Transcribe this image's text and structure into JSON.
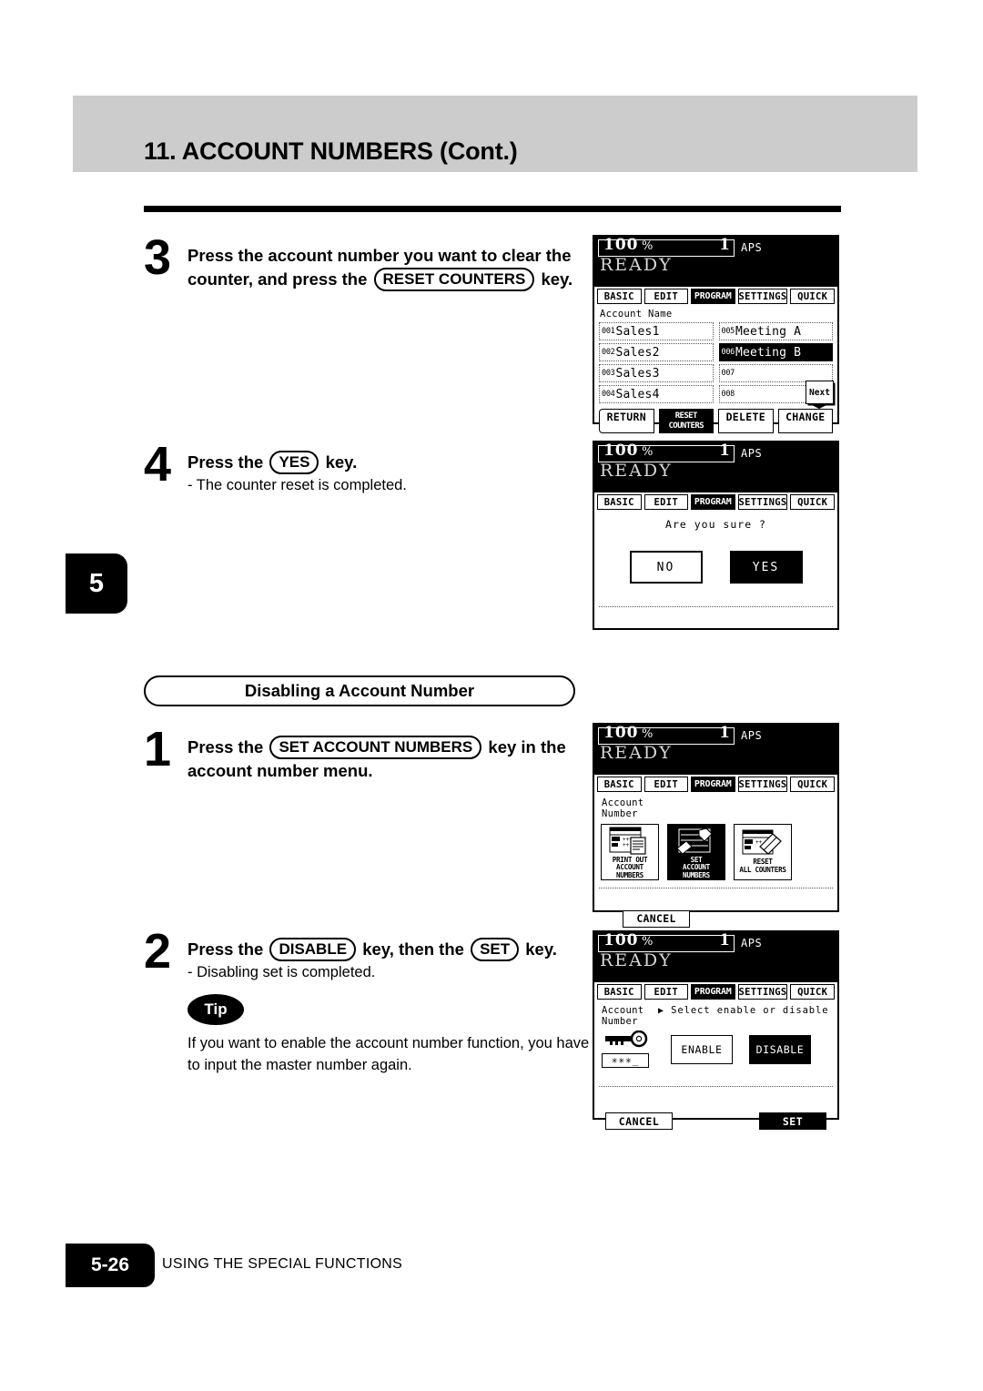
{
  "header": {
    "title": "11. ACCOUNT NUMBERS (Cont.)"
  },
  "chapter_tab": "5",
  "footer": {
    "page": "5-26",
    "text": "USING THE SPECIAL FUNCTIONS"
  },
  "section_heading": "Disabling a Account Number",
  "steps": {
    "step3": {
      "num": "3",
      "line1": "Press the account number you want to clear the",
      "line2a": "counter, and press the",
      "key": "RESET COUNTERS",
      "line2b": "key."
    },
    "step4": {
      "num": "4",
      "pre": "Press the",
      "key": "YES",
      "post": "key.",
      "sub": "- The counter reset is completed."
    },
    "step1": {
      "num": "1",
      "pre": "Press the",
      "key": "SET ACCOUNT NUMBERS",
      "post": "key in the",
      "line2": "account number menu."
    },
    "step2": {
      "num": "2",
      "pre": "Press the",
      "key1": "DISABLE",
      "mid": "key, then the",
      "key2": "SET",
      "post": "key.",
      "sub": "- Disabling set is completed.",
      "tip_badge": "Tip",
      "tip_text": "If you want to enable the account number function, you have to input the master number again."
    }
  },
  "lcd_common": {
    "ratio": "100",
    "percent": "%",
    "copies": "1",
    "aps": "APS",
    "ready": "READY",
    "tabs": [
      {
        "label": "BASIC",
        "selected": false
      },
      {
        "label": "EDIT",
        "selected": false
      },
      {
        "label": "PROGRAM",
        "selected": true
      },
      {
        "label": "SETTINGS",
        "selected": false
      },
      {
        "label": "QUICK",
        "selected": false
      }
    ]
  },
  "lcd1": {
    "list_label": "Account Name",
    "col_left": [
      {
        "index": "001",
        "name": "Sales1",
        "selected": false
      },
      {
        "index": "002",
        "name": "Sales2",
        "selected": false
      },
      {
        "index": "003",
        "name": "Sales3",
        "selected": false
      },
      {
        "index": "004",
        "name": "Sales4",
        "selected": false
      }
    ],
    "col_right": [
      {
        "index": "005",
        "name": "Meeting A",
        "selected": false
      },
      {
        "index": "006",
        "name": "Meeting B",
        "selected": true
      },
      {
        "index": "007",
        "name": "",
        "selected": false
      },
      {
        "index": "008",
        "name": "",
        "selected": false
      }
    ],
    "next_key": "Next",
    "actions": [
      {
        "label": "RETURN",
        "selected": false,
        "style": "arrowl"
      },
      {
        "label": "RESET COUNTERS",
        "selected": true,
        "style": "dense"
      },
      {
        "label": "DELETE",
        "selected": false,
        "style": ""
      },
      {
        "label": "CHANGE",
        "selected": false,
        "style": ""
      }
    ]
  },
  "lcd2": {
    "message": "Are you sure ?",
    "no_label": "NO",
    "yes_label": "YES",
    "yes_selected": true
  },
  "lcd3": {
    "label_line1": "Account",
    "label_line2": "Number",
    "menu": [
      {
        "line1": "PRINT OUT",
        "line2": "ACCOUNT NUMBERS",
        "icon": "printout-account-numbers-icon",
        "selected": false
      },
      {
        "line1": "SET",
        "line2": "ACCOUNT NUMBERS",
        "icon": "set-account-numbers-icon",
        "selected": true
      },
      {
        "line1": "RESET",
        "line2": "ALL COUNTERS",
        "icon": "reset-all-counters-icon",
        "selected": false
      }
    ],
    "cancel_label": "CANCEL"
  },
  "lcd4": {
    "label_line1": "Account",
    "label_line2": "Number",
    "prompt": "Select enable or disable",
    "prompt_marker": "▶",
    "key_mask": "✳✳✳_",
    "enable_label": "ENABLE",
    "disable_label": "DISABLE",
    "disable_selected": true,
    "cancel_label": "CANCEL",
    "set_label": "SET"
  }
}
